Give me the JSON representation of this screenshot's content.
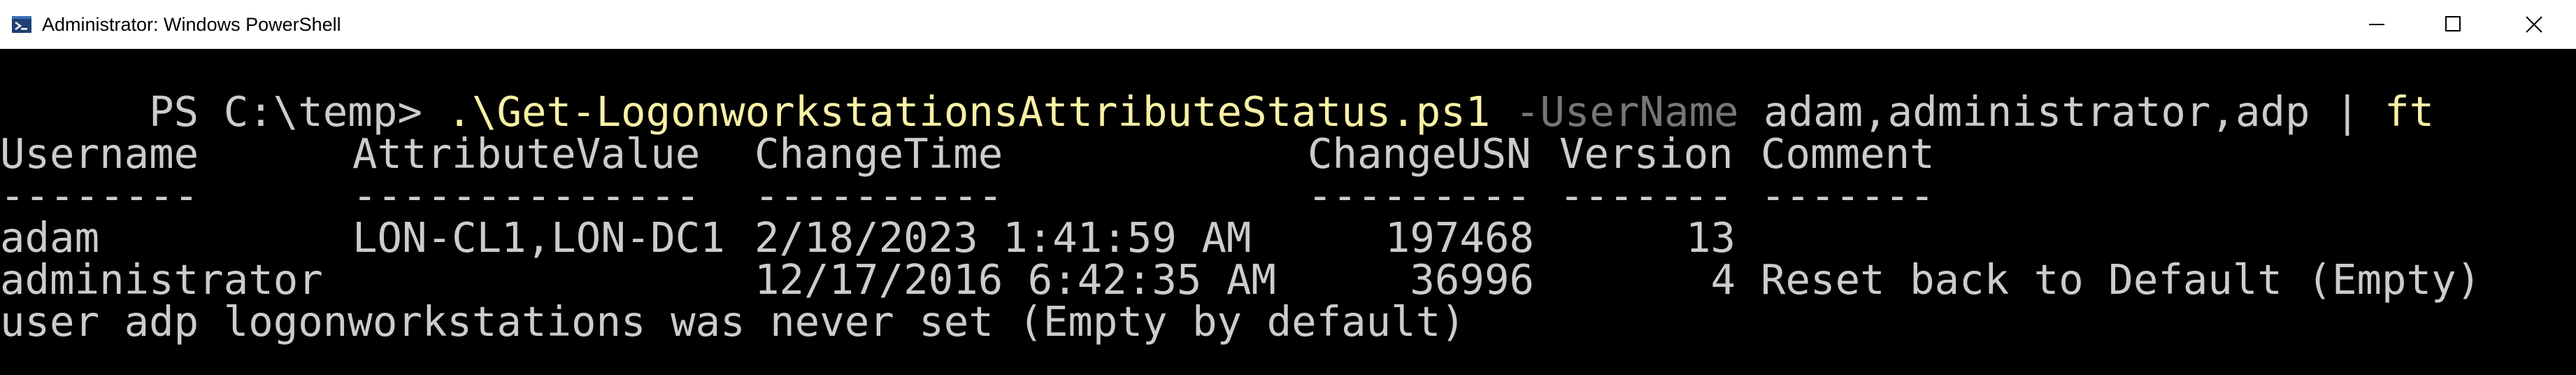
{
  "window": {
    "title": "Administrator: Windows PowerShell",
    "icon": "powershell-icon",
    "buttons": [
      "minimize-icon",
      "maximize-icon",
      "close-icon"
    ]
  },
  "colors": {
    "background": "#000000",
    "text": "#cccccc",
    "command": "#f9f1a5",
    "parameter": "#767676",
    "titlebar": "#ffffff"
  },
  "console": {
    "prompt_line": {
      "prompt": "PS C:\\temp> ",
      "command": ".\\Get-LogonworkstationsAttributeStatus.ps1",
      "parameter": "-UserName",
      "argument": "adam,administrator,adp",
      "pipe": "|",
      "pipe_command": "ft"
    },
    "table": {
      "headers": [
        "Username",
        "AttributeValue",
        "ChangeTime",
        "ChangeUSN",
        "Version",
        "Comment"
      ],
      "separators": [
        "--------",
        "--------------",
        "----------",
        "---------",
        "-------",
        "-------"
      ],
      "rows": [
        [
          "adam",
          "LON-CL1,LON-DC1",
          "2/18/2023 1:41:59 AM",
          "197468",
          "13",
          ""
        ],
        [
          "administrator",
          "",
          "12/17/2016 6:42:35 AM",
          "36996",
          "4",
          "Reset back to Default (Empty)"
        ]
      ]
    },
    "message": "user adp logonworkstations was never set (Empty by default)"
  }
}
